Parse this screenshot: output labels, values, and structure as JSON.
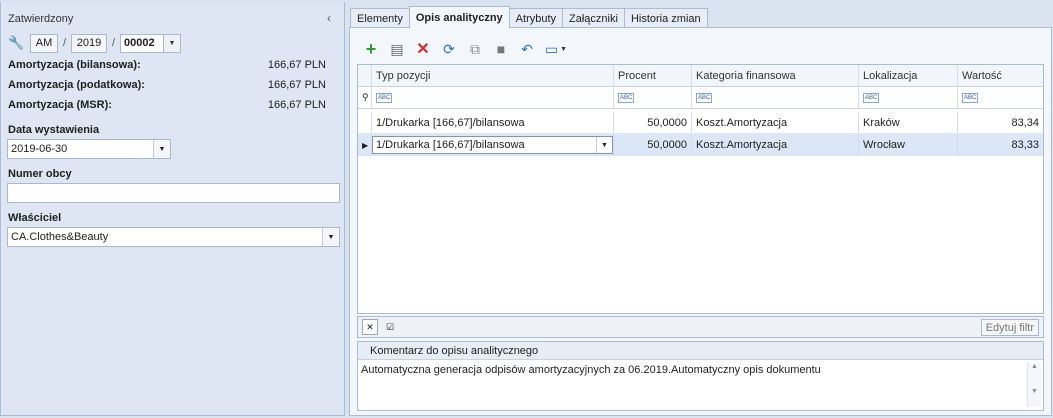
{
  "left": {
    "status": "Zatwierdzony",
    "doc_prefix": "AM",
    "doc_year": "2019",
    "doc_number": "00002",
    "amort": [
      {
        "label": "Amortyzacja (bilansowa):",
        "value": "166,67 PLN"
      },
      {
        "label": "Amortyzacja (podatkowa):",
        "value": "166,67 PLN"
      },
      {
        "label": "Amortyzacja (MSR):",
        "value": "166,67 PLN"
      }
    ],
    "date_label": "Data wystawienia",
    "date_value": "2019-06-30",
    "foreign_label": "Numer obcy",
    "foreign_value": "",
    "owner_label": "Właściciel",
    "owner_value": "CA.Clothes&Beauty"
  },
  "tabs": [
    "Elementy",
    "Opis analityczny",
    "Atrybuty",
    "Załączniki",
    "Historia zmian"
  ],
  "grid": {
    "columns": [
      "Typ pozycji",
      "Procent",
      "Kategoria finansowa",
      "Lokalizacja",
      "Wartość"
    ],
    "rows": [
      [
        "1/Drukarka [166,67]/bilansowa",
        "50,0000",
        "Koszt.Amortyzacja",
        "Kraków",
        "83,34"
      ],
      [
        "1/Drukarka [166,67]/bilansowa",
        "50,0000",
        "Koszt.Amortyzacja",
        "Wrocław",
        "83,33"
      ]
    ]
  },
  "edit_filter": "Edytuj filtr",
  "comment": {
    "title": "Komentarz do opisu analitycznego",
    "text": "Automatyczna generacja odpisów amortyzacyjnych za 06.2019.Automatyczny opis dokumentu"
  },
  "icons": [
    "add-icon",
    "edit-icon",
    "delete-icon",
    "refresh-icon",
    "copy-icon",
    "save-icon",
    "undo-icon",
    "export-icon"
  ],
  "colors": {
    "add": "#2e9b2e",
    "delete": "#d22b2b",
    "refresh": "#2a70c2"
  }
}
